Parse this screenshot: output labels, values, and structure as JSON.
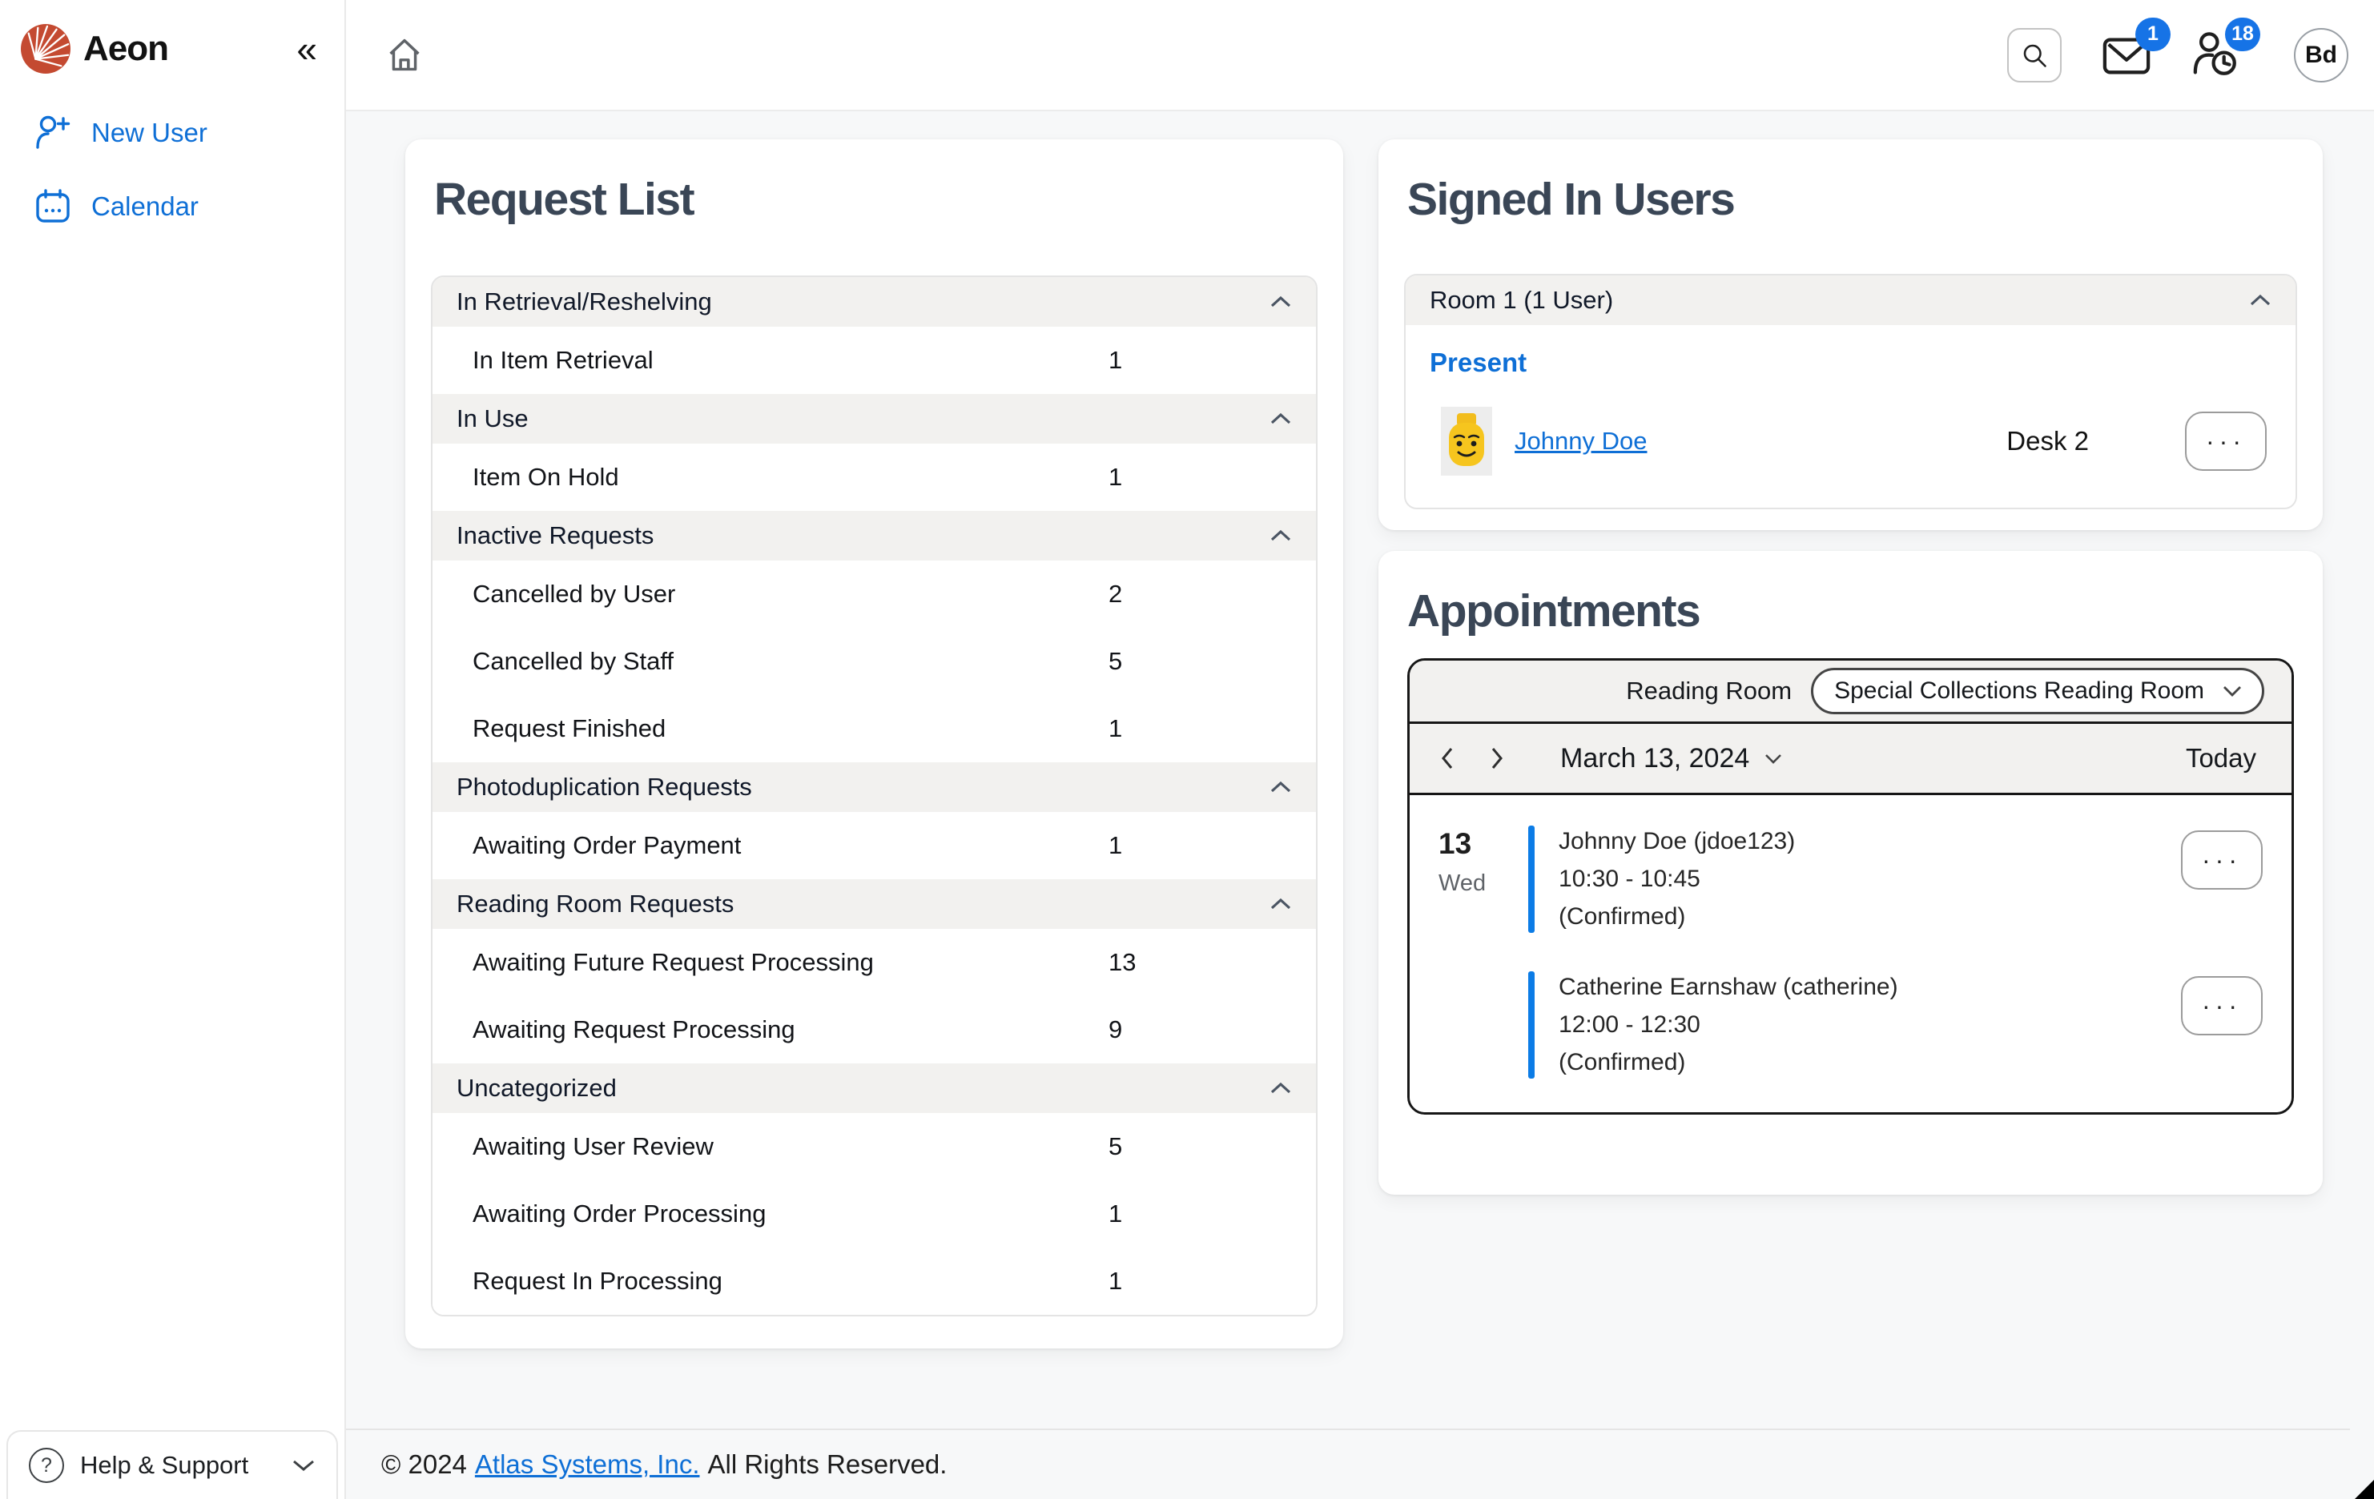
{
  "brand": {
    "name": "Aeon"
  },
  "icons": {
    "collapse": "«",
    "ellipsis": "···",
    "question": "?"
  },
  "sidebar": {
    "items": [
      {
        "label": "New User"
      },
      {
        "label": "Calendar"
      }
    ],
    "help_label": "Help & Support"
  },
  "topbar": {
    "mail_badge": "1",
    "users_badge": "18",
    "avatar_initials": "Bd"
  },
  "request_list": {
    "title": "Request List",
    "sections": [
      {
        "label": "In Retrieval/Reshelving",
        "items": [
          {
            "label": "In Item Retrieval",
            "count": "1"
          }
        ]
      },
      {
        "label": "In Use",
        "items": [
          {
            "label": "Item On Hold",
            "count": "1"
          }
        ]
      },
      {
        "label": "Inactive Requests",
        "items": [
          {
            "label": "Cancelled by User",
            "count": "2"
          },
          {
            "label": "Cancelled by Staff",
            "count": "5"
          },
          {
            "label": "Request Finished",
            "count": "1"
          }
        ]
      },
      {
        "label": "Photoduplication Requests",
        "items": [
          {
            "label": "Awaiting Order Payment",
            "count": "1"
          }
        ]
      },
      {
        "label": "Reading Room Requests",
        "items": [
          {
            "label": "Awaiting Future Request Processing",
            "count": "13"
          },
          {
            "label": "Awaiting Request Processing",
            "count": "9"
          }
        ]
      },
      {
        "label": "Uncategorized",
        "items": [
          {
            "label": "Awaiting User Review",
            "count": "5"
          },
          {
            "label": "Awaiting Order Processing",
            "count": "1"
          },
          {
            "label": "Request In Processing",
            "count": "1"
          }
        ]
      }
    ]
  },
  "signed_in_users": {
    "title": "Signed In Users",
    "room_header": "Room 1 (1 User)",
    "status_label": "Present",
    "user": {
      "name": "Johnny Doe",
      "desk": "Desk 2"
    }
  },
  "appointments": {
    "title": "Appointments",
    "reading_room_label": "Reading Room",
    "reading_room_value": "Special Collections Reading Room",
    "date_label": "March 13, 2024",
    "today_label": "Today",
    "day_number": "13",
    "day_name": "Wed",
    "entries": [
      {
        "name": "Johnny Doe (jdoe123)",
        "time": "10:30 - 10:45",
        "status": "(Confirmed)"
      },
      {
        "name": "Catherine Earnshaw (catherine)",
        "time": "12:00 - 12:30",
        "status": "(Confirmed)"
      }
    ]
  },
  "footer": {
    "prefix": "© 2024",
    "link": "Atlas Systems, Inc.",
    "suffix": "All Rights Reserved."
  },
  "colors": {
    "accent_blue": "#0e6fd6",
    "badge_blue": "#1673e6",
    "logo_red": "#c44a31",
    "appointment_bar_blue": "#0c7ce6"
  }
}
